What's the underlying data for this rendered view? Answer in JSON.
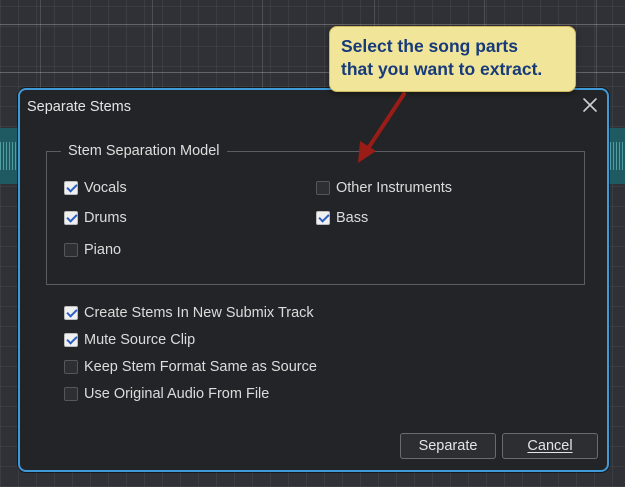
{
  "tooltip": {
    "lines": [
      "Select the song parts",
      "that you want to extract."
    ]
  },
  "dialog": {
    "title": "Separate Stems",
    "close_icon": "close-x-icon",
    "model_group": {
      "title": "Stem Separation Model",
      "options": [
        {
          "label": "Vocals",
          "checked": true
        },
        {
          "label": "Other Instruments",
          "checked": false
        },
        {
          "label": "Drums",
          "checked": true
        },
        {
          "label": "Bass",
          "checked": true
        },
        {
          "label": "Piano",
          "checked": false
        }
      ]
    },
    "options": [
      {
        "label": "Create Stems In New Submix Track",
        "checked": true
      },
      {
        "label": "Mute Source Clip",
        "checked": true
      },
      {
        "label": "Keep Stem Format Same as Source",
        "checked": false
      },
      {
        "label": "Use Original Audio From File",
        "checked": false
      }
    ],
    "buttons": {
      "separate": "Separate",
      "cancel": "Cancel"
    }
  },
  "colors": {
    "dialog_border": "#3f9ad8",
    "tooltip_bg": "#f1e59a",
    "tooltip_text": "#163a7a",
    "arrow": "#9a1c17"
  }
}
